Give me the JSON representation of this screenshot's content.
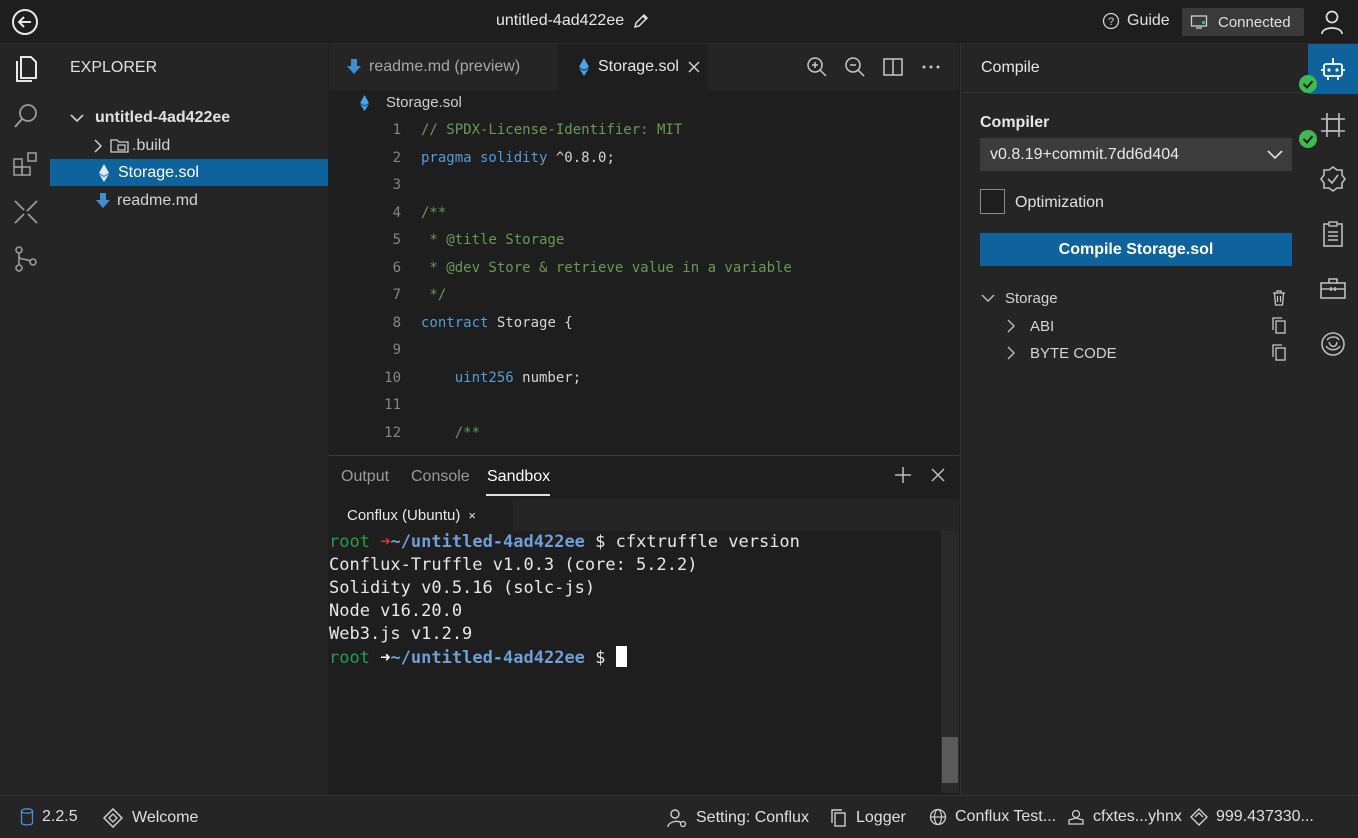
{
  "topbar": {
    "project_title": "untitled-4ad422ee",
    "guide_label": "Guide",
    "connected_label": "Connected"
  },
  "explorer": {
    "title": "EXPLORER",
    "project": "untitled-4ad422ee",
    "items": [
      {
        "label": ".build",
        "type": "folder"
      },
      {
        "label": "Storage.sol",
        "type": "solidity",
        "selected": true
      },
      {
        "label": "readme.md",
        "type": "markdown"
      }
    ]
  },
  "editor": {
    "tabs": [
      {
        "label": "readme.md (preview)",
        "active": false
      },
      {
        "label": "Storage.sol",
        "active": true
      }
    ],
    "breadcrumb": "Storage.sol",
    "lines": [
      {
        "n": "1",
        "parts": [
          {
            "t": "// SPDX-License-Identifier: MIT",
            "c": "cm"
          }
        ]
      },
      {
        "n": "2",
        "parts": [
          {
            "t": "pragma solidity",
            "c": "kw"
          },
          {
            "t": " ^0.8.0;",
            "c": ""
          }
        ]
      },
      {
        "n": "3",
        "parts": []
      },
      {
        "n": "4",
        "parts": [
          {
            "t": "/**",
            "c": "cm"
          }
        ]
      },
      {
        "n": "5",
        "parts": [
          {
            "t": " * @title Storage",
            "c": "cm"
          }
        ]
      },
      {
        "n": "6",
        "parts": [
          {
            "t": " * @dev Store & retrieve value in a variable",
            "c": "cm"
          }
        ]
      },
      {
        "n": "7",
        "parts": [
          {
            "t": " */",
            "c": "cm"
          }
        ]
      },
      {
        "n": "8",
        "parts": [
          {
            "t": "contract",
            "c": "kw"
          },
          {
            "t": " Storage {",
            "c": ""
          }
        ]
      },
      {
        "n": "9",
        "parts": []
      },
      {
        "n": "10",
        "parts": [
          {
            "t": "    uint256",
            "c": "kw"
          },
          {
            "t": " number;",
            "c": ""
          }
        ]
      },
      {
        "n": "11",
        "parts": []
      },
      {
        "n": "12",
        "parts": [
          {
            "t": "    /**",
            "c": "cm"
          }
        ]
      }
    ]
  },
  "panel": {
    "tabs": [
      "Output",
      "Console",
      "Sandbox"
    ],
    "active_tab": "Sandbox",
    "terminal_tab": "Conflux (Ubuntu)",
    "terminal_close": "×",
    "prompt_user": "root",
    "prompt_arrow": "➜",
    "prompt_path": "~/untitled-4ad422ee",
    "prompt_sign": "$",
    "command": "cfxtruffle version",
    "output": [
      "Conflux-Truffle v1.0.3 (core: 5.2.2)",
      "Solidity v0.5.16 (solc-js)",
      "Node v16.20.0",
      "Web3.js v1.2.9"
    ]
  },
  "compile": {
    "title": "Compile",
    "compiler_label": "Compiler",
    "compiler_version": "v0.8.19+commit.7dd6d404",
    "optimization_label": "Optimization",
    "button_label": "Compile Storage.sol",
    "contract": "Storage",
    "children": [
      "ABI",
      "BYTE CODE"
    ]
  },
  "statusbar": {
    "version": "2.2.5",
    "welcome": "Welcome",
    "setting": "Setting: Conflux",
    "logger": "Logger",
    "network": "Conflux Test...",
    "account": "cfxtes...yhnx",
    "balance": "999.437330..."
  },
  "colors": {
    "accent": "#0e639c",
    "success": "#3fb950",
    "prompt_green": "#22a049",
    "prompt_red": "#e03131"
  }
}
